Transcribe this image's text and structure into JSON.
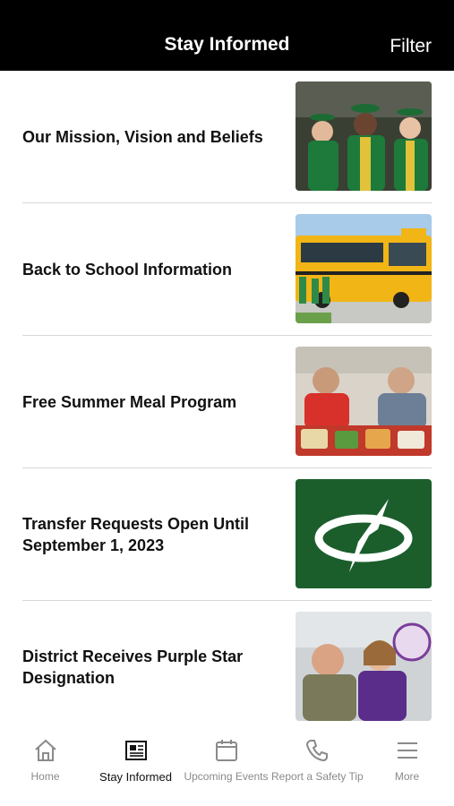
{
  "header": {
    "title": "Stay Informed",
    "filter_label": "Filter"
  },
  "articles": [
    {
      "title": "Our Mission, Vision and Beliefs",
      "image": "graduates-photo"
    },
    {
      "title": "Back to School Information",
      "image": "school-bus-photo"
    },
    {
      "title": "Free Summer Meal Program",
      "image": "students-lunch-photo"
    },
    {
      "title": "Transfer Requests Open Until September 1, 2023",
      "image": "district-logo"
    },
    {
      "title": "District Receives Purple Star Designation",
      "image": "military-family-photo"
    }
  ],
  "tabs": [
    {
      "label": "Home",
      "icon": "home-icon"
    },
    {
      "label": "Stay Informed",
      "icon": "newspaper-icon",
      "active": true
    },
    {
      "label": "Upcoming Events",
      "icon": "calendar-icon"
    },
    {
      "label": "Report a Safety Tip",
      "icon": "phone-icon"
    },
    {
      "label": "More",
      "icon": "menu-icon"
    }
  ],
  "colors": {
    "header_bg": "#000000",
    "logo_green": "#1b5e2c",
    "active_tab": "#111111",
    "inactive_tab": "#8a8a8a"
  }
}
